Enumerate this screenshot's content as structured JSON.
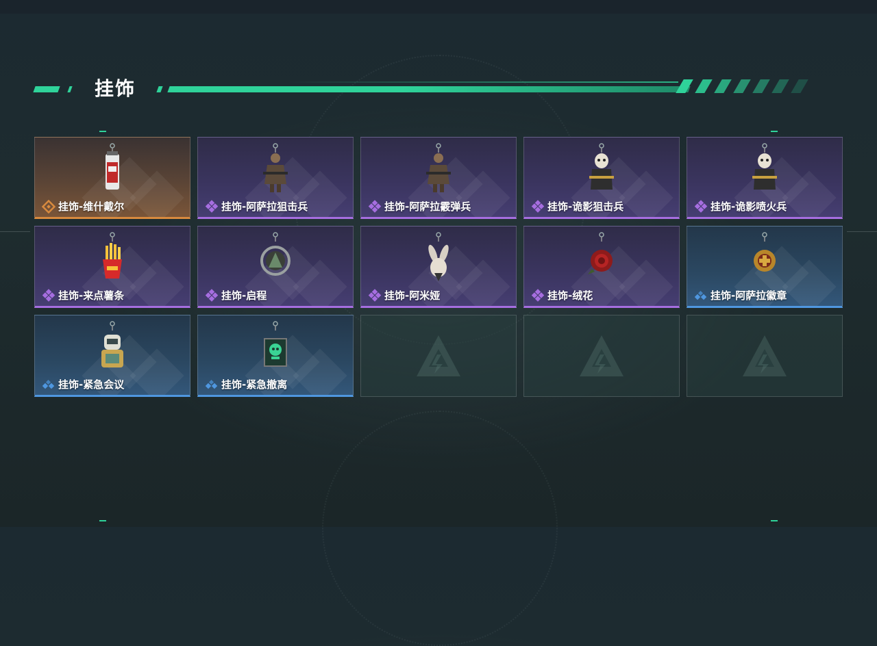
{
  "section": {
    "title": "挂饰"
  },
  "colors": {
    "accent": "#2fd39a",
    "rarity_orange": "#d88a3e",
    "rarity_purple": "#a66ee0",
    "rarity_blue": "#4f97e0"
  },
  "items": [
    {
      "label": "挂饰-维什戴尔",
      "rarity": "orange",
      "icon": "vial-pendant-icon"
    },
    {
      "label": "挂饰-阿萨拉狙击兵",
      "rarity": "purple",
      "icon": "soldier-figure-icon"
    },
    {
      "label": "挂饰-阿萨拉霰弹兵",
      "rarity": "purple",
      "icon": "soldier-figure-icon"
    },
    {
      "label": "挂饰-诡影狙击兵",
      "rarity": "purple",
      "icon": "masked-figure-icon"
    },
    {
      "label": "挂饰-诡影喷火兵",
      "rarity": "purple",
      "icon": "masked-figure-icon"
    },
    {
      "label": "挂饰-来点薯条",
      "rarity": "purple",
      "icon": "fries-icon"
    },
    {
      "label": "挂饰-启程",
      "rarity": "purple",
      "icon": "ring-emblem-icon"
    },
    {
      "label": "挂饰-阿米娅",
      "rarity": "purple",
      "icon": "bunny-icon"
    },
    {
      "label": "挂饰-绒花",
      "rarity": "purple",
      "icon": "rose-icon"
    },
    {
      "label": "挂饰-阿萨拉徽章",
      "rarity": "blue",
      "icon": "badge-icon"
    },
    {
      "label": "挂饰-紧急会议",
      "rarity": "blue",
      "icon": "robot-icon"
    },
    {
      "label": "挂饰-紧急撤离",
      "rarity": "blue",
      "icon": "skull-box-icon"
    }
  ],
  "empty_slots": 3
}
